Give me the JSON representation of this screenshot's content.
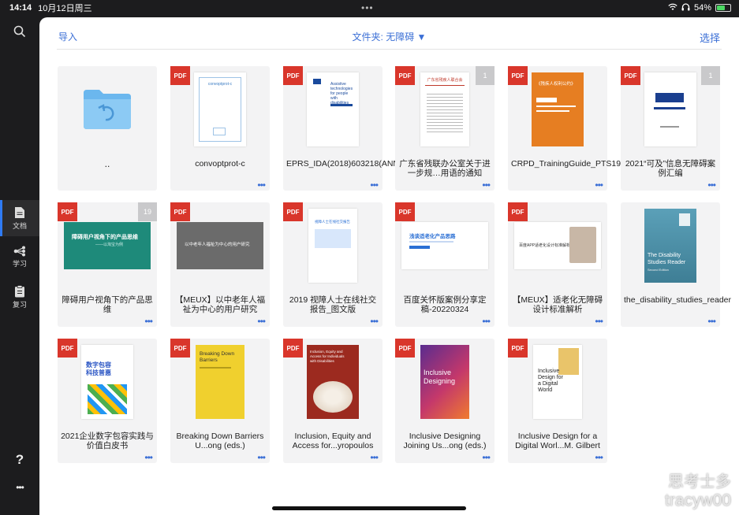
{
  "status": {
    "time": "14:14",
    "date": "10月12日周三",
    "battery": "54%",
    "battery_level": 0.54
  },
  "sidebar": {
    "items": [
      {
        "label": "文档",
        "icon": "document-icon",
        "active": true
      },
      {
        "label": "学习",
        "icon": "learn-icon",
        "active": false
      },
      {
        "label": "复习",
        "icon": "review-icon",
        "active": false
      }
    ],
    "help": "?",
    "more": "•••"
  },
  "toolbar": {
    "import": "导入",
    "folder": "文件夹: 无障碍 ▼",
    "select": "选择"
  },
  "files": [
    {
      "title": "..",
      "type": "folder"
    },
    {
      "title": "convoptprot-c",
      "type": "pdf"
    },
    {
      "title": "EPRS_IDA(2018)603218(ANN2)_EN",
      "type": "pdf"
    },
    {
      "title": "广东省残联办公室关于进一步规…用语的通知",
      "type": "pdf",
      "count": "1"
    },
    {
      "title": "CRPD_TrainingGuide_PTS19_CH",
      "type": "pdf"
    },
    {
      "title": "2021“可及”信息无障碍案例汇编",
      "type": "pdf",
      "count": "1"
    },
    {
      "title": "障碍用户视角下的产品思维",
      "type": "pdf",
      "count": "19"
    },
    {
      "title": "【MEUX】以中老年人福祉为中心的用户研究",
      "type": "pdf"
    },
    {
      "title": "2019 视障人士在线社交报告_图文版",
      "type": "pdf"
    },
    {
      "title": "百度关怀版案例分享定稿-20220324",
      "type": "pdf"
    },
    {
      "title": "【MEUX】适老化无障碍设计标准解析",
      "type": "pdf"
    },
    {
      "title": "the_disability_studies_reader",
      "type": "pdf"
    },
    {
      "title": "2021企业数字包容实践与价值白皮书",
      "type": "pdf"
    },
    {
      "title": "Breaking Down Barriers U...ong (eds.)",
      "type": "pdf"
    },
    {
      "title": "Inclusion, Equity and Access for...yropoulos",
      "type": "pdf"
    },
    {
      "title": "Inclusive Designing Joining Us...ong (eds.)",
      "type": "pdf"
    },
    {
      "title": "Inclusive Design for a Digital Worl...M. Gilbert",
      "type": "pdf"
    }
  ],
  "thumbs": {
    "t1": "convoptprot-c",
    "t2": "Assistive technologies for people with disabilities",
    "t3": "广东省残疾人联合会",
    "t4": "《残疾人权利公约》",
    "t6a": "障碍用户视角下的产品思维",
    "t6b": "——以淘宝为例",
    "t7": "以中老年人福祉为中心的用户研究",
    "t8": "视障人士在线社交报告",
    "t9": "浅谈适老化产品思路",
    "t10": "百度APP适老化设计标准解析",
    "t11a": "The Disability",
    "t11b": "Studies Reader",
    "t11c": "Second Edition",
    "t12a": "数字包容",
    "t12b": "科技普惠",
    "t13a": "Breaking Down",
    "t13b": "Barriers",
    "t14a": "Inclusion, Equity and",
    "t14b": "Access for Individuals",
    "t14c": "with Disabilities",
    "t15a": "Inclusive",
    "t15b": "Designing",
    "t16a": "Inclusive",
    "t16b": "Design for",
    "t16c": "a Digital",
    "t16d": "World"
  },
  "pdf_label": "PDF",
  "more_label": "•••",
  "watermark": {
    "line1": "思考士多",
    "line2": "tracyw00"
  }
}
